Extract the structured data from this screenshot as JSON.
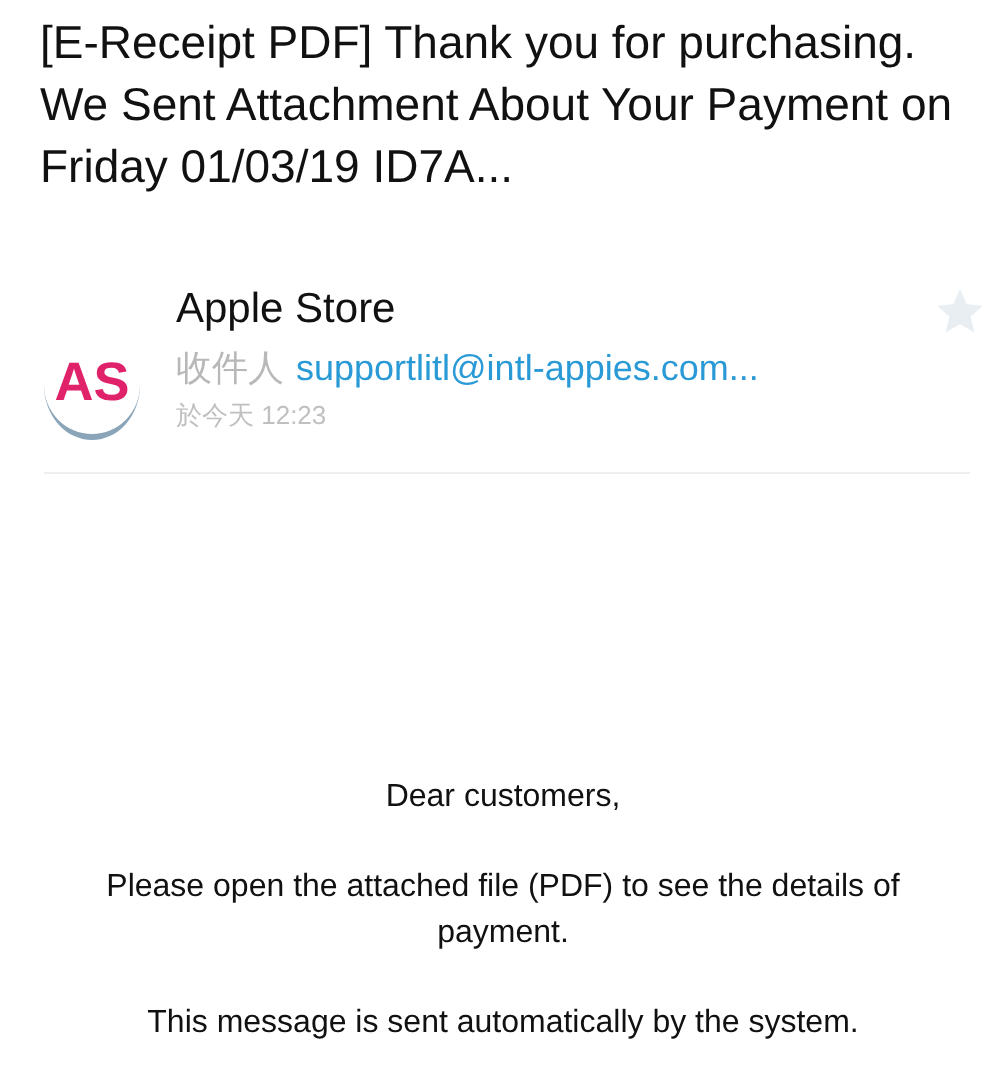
{
  "subject": "[E-Receipt PDF] Thank you for purchasing. We Sent Attachment About Your Payment on Friday 01/03/19 ID7A...",
  "sender": {
    "logo_text": "AS",
    "name": "Apple Store",
    "to_label": "收件人",
    "to_address": "supportlitl@intl-appies.com...",
    "time": "於今天 12:23",
    "starred": false
  },
  "body": [
    "Dear customers,",
    "Please open the attached file (PDF) to see the details of payment.",
    "This message is sent automatically by the system."
  ]
}
